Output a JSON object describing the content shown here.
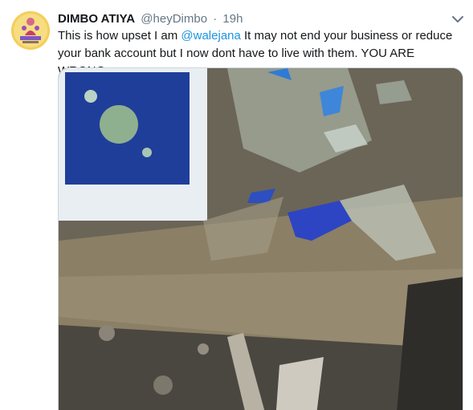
{
  "tweet": {
    "name": "DIMBO ATIYA",
    "handle": "@heyDimbo",
    "separator": "·",
    "time": "19h",
    "text_before": "This is how upset I am ",
    "mention": "@walejana",
    "text_after": " It may not end your business or reduce your bank account but I now dont have to live with them. YOU ARE WRONG."
  },
  "colors": {
    "link": "#1b95e0",
    "muted": "#657786",
    "text": "#14171a"
  },
  "icons": {
    "menu": "chevron-down-icon",
    "avatar": "avatar-image"
  }
}
